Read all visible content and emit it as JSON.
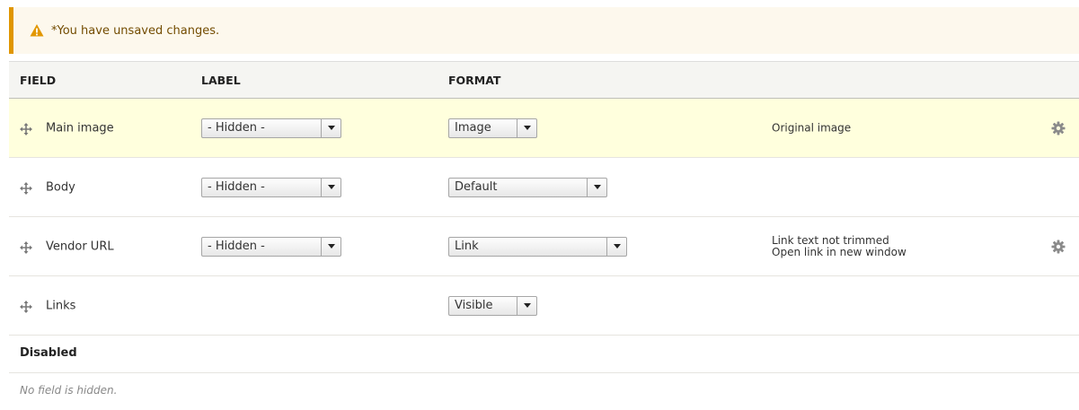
{
  "warning": {
    "icon": "warning-triangle-icon",
    "message": "*You have unsaved changes.",
    "accent_color": "#e09600"
  },
  "table": {
    "headers": {
      "field": "FIELD",
      "label": "LABEL",
      "format": "FORMAT"
    },
    "rows": [
      {
        "field": "Main image",
        "label": "- Hidden -",
        "format": "Image",
        "summary": [
          "Original image"
        ],
        "has_settings": true,
        "highlighted": true
      },
      {
        "field": "Body",
        "label": "- Hidden -",
        "format": "Default",
        "summary": [],
        "has_settings": false,
        "highlighted": false
      },
      {
        "field": "Vendor URL",
        "label": "- Hidden -",
        "format": "Link",
        "summary": [
          "Link text not trimmed",
          "Open link in new window"
        ],
        "has_settings": true,
        "highlighted": false
      },
      {
        "field": "Links",
        "label": null,
        "format": "Visible",
        "summary": [],
        "has_settings": false,
        "highlighted": false
      }
    ]
  },
  "disabled_region": {
    "title": "Disabled",
    "empty_message": "No field is hidden."
  },
  "colors": {
    "highlight_row": "#ffffdd",
    "header_bg": "#f5f5f2"
  }
}
